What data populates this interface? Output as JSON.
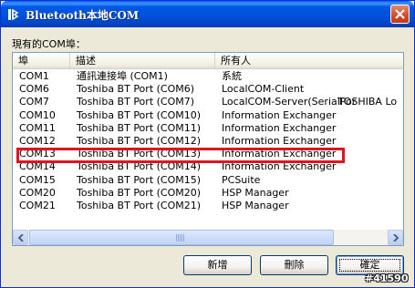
{
  "window": {
    "title": "Bluetooth本地COM",
    "section_label": "現有的COM埠："
  },
  "list": {
    "columns": [
      "埠",
      "描述",
      "所有人"
    ],
    "rows": [
      {
        "port": "COM1",
        "description": "通訊連接埠 (COM1)",
        "owner": "系統",
        "extra": ""
      },
      {
        "port": "COM6",
        "description": "Toshiba BT Port (COM6)",
        "owner": "LocalCOM-Client",
        "extra": ""
      },
      {
        "port": "COM7",
        "description": "Toshiba BT Port (COM7)",
        "owner": "LocalCOM-Server(SerialPor",
        "extra": "TOSHIBA Lo"
      },
      {
        "port": "COM10",
        "description": "Toshiba BT Port (COM10)",
        "owner": "Information Exchanger",
        "extra": ""
      },
      {
        "port": "COM11",
        "description": "Toshiba BT Port (COM11)",
        "owner": "Information Exchanger",
        "extra": ""
      },
      {
        "port": "COM12",
        "description": "Toshiba BT Port (COM12)",
        "owner": "Information Exchanger",
        "extra": ""
      },
      {
        "port": "COM13",
        "description": "Toshiba BT Port (COM13)",
        "owner": "Information Exchanger",
        "extra": ""
      },
      {
        "port": "COM14",
        "description": "Toshiba BT Port (COM14)",
        "owner": "Information Exchanger",
        "extra": ""
      },
      {
        "port": "COM15",
        "description": "Toshiba BT Port (COM15)",
        "owner": "PCSuite",
        "extra": ""
      },
      {
        "port": "COM20",
        "description": "Toshiba BT Port (COM20)",
        "owner": "HSP Manager",
        "extra": ""
      },
      {
        "port": "COM21",
        "description": "Toshiba BT Port (COM21)",
        "owner": "HSP Manager",
        "extra": ""
      }
    ]
  },
  "buttons": {
    "add": "新增",
    "delete": "刪除",
    "ok": "確定"
  },
  "watermark": "#41590",
  "colors": {
    "titlebar": "#0058E6",
    "highlight_box": "#E0141E",
    "close_button": "#D44A26"
  },
  "icons": {
    "title": "bluetooth-com-icon",
    "close": "close-icon",
    "scroll_left": "arrow-left-icon",
    "scroll_right": "arrow-right-icon"
  }
}
